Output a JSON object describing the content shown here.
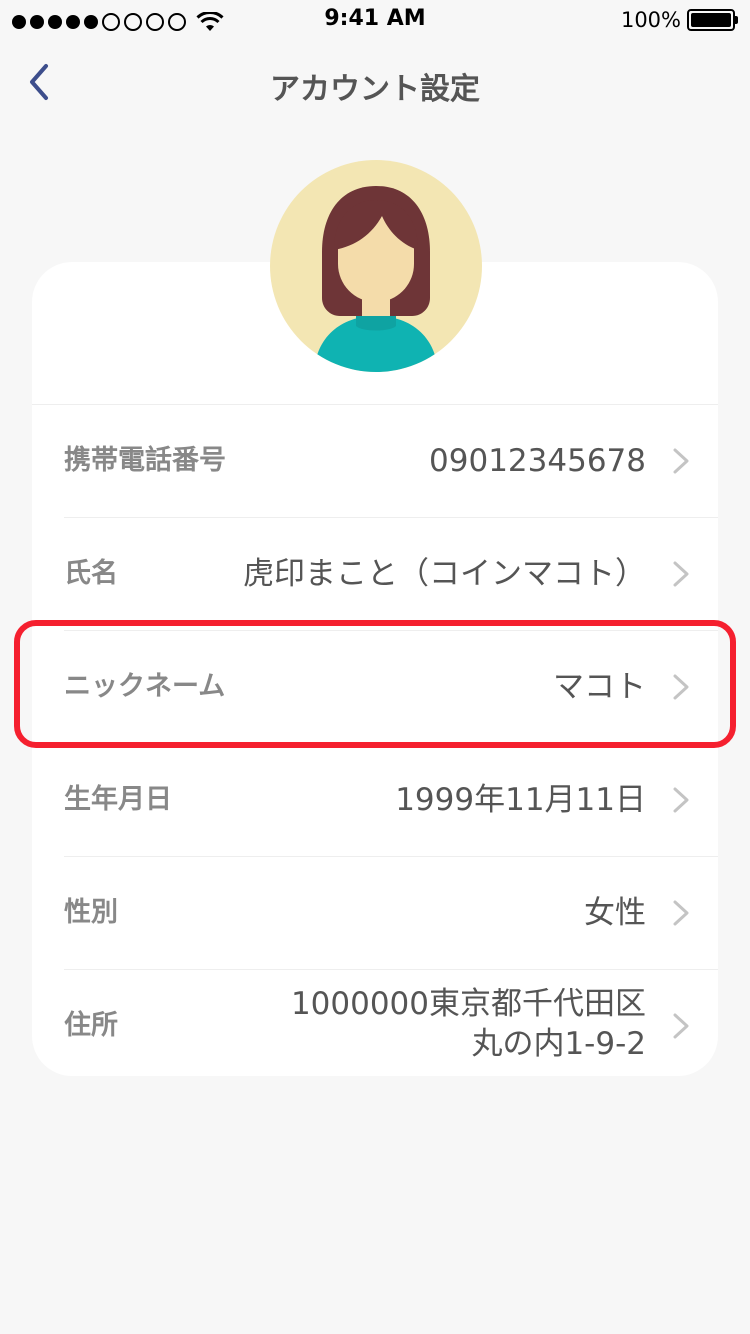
{
  "status_bar": {
    "time": "9:41 AM",
    "battery_percent": "100%",
    "signal_filled": 5,
    "signal_empty": 4
  },
  "nav": {
    "title": "アカウント設定",
    "back_icon": "chevron-left-icon"
  },
  "profile": {
    "avatar_icon": "user-avatar-icon"
  },
  "rows": [
    {
      "label": "携帯電話番号",
      "value": "09012345678"
    },
    {
      "label": "氏名",
      "value": "虎印まこと（コインマコト）"
    },
    {
      "label": "ニックネーム",
      "value": "マコト"
    },
    {
      "label": "生年月日",
      "value": "1999年11月11日"
    },
    {
      "label": "性別",
      "value": "女性"
    },
    {
      "label": "住所",
      "value_line1": "1000000東京都千代田区",
      "value_line2": "丸の内1-9-2"
    }
  ],
  "colors": {
    "background": "#f7f7f7",
    "card": "#ffffff",
    "accent_back": "#3d4e8c",
    "highlight": "#f5202f",
    "avatar_bg": "#f3e6b3",
    "hair": "#6e3537",
    "skin": "#f4dcaa",
    "shirt": "#0fb3b2"
  }
}
